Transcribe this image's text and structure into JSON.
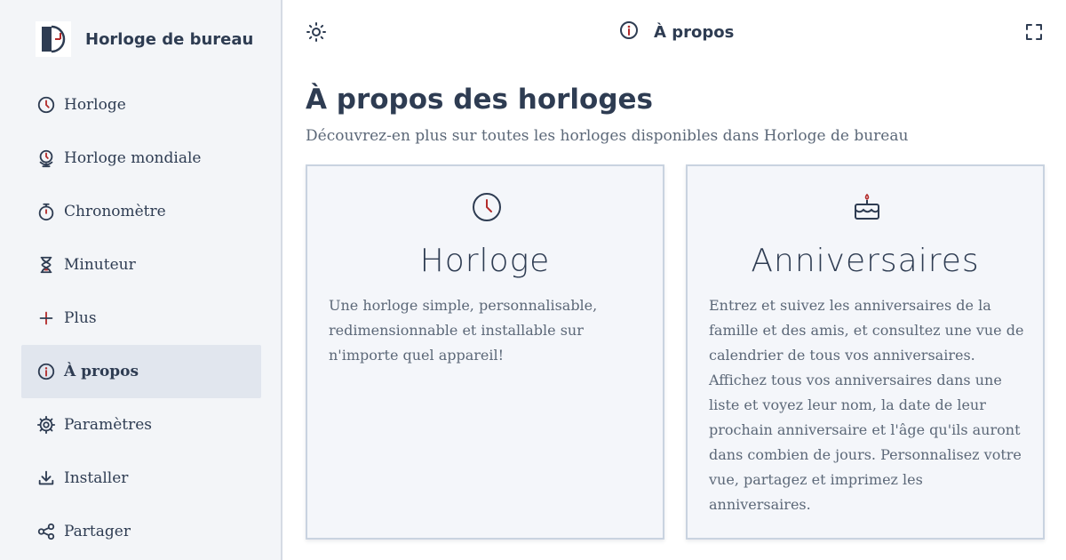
{
  "app": {
    "title": "Horloge de bureau",
    "logo_icon": "desk-clock-logo"
  },
  "sidebar": {
    "items": [
      {
        "label": "Horloge",
        "icon": "clock-icon",
        "active": false
      },
      {
        "label": "Horloge mondiale",
        "icon": "world-clock-icon",
        "active": false
      },
      {
        "label": "Chronomètre",
        "icon": "stopwatch-icon",
        "active": false
      },
      {
        "label": "Minuteur",
        "icon": "hourglass-icon",
        "active": false
      },
      {
        "label": "Plus",
        "icon": "plus-icon",
        "active": false
      },
      {
        "label": "À propos",
        "icon": "info-icon",
        "active": true
      },
      {
        "label": "Paramètres",
        "icon": "gear-icon",
        "active": false
      },
      {
        "label": "Installer",
        "icon": "download-icon",
        "active": false
      },
      {
        "label": "Partager",
        "icon": "share-icon",
        "active": false
      }
    ]
  },
  "topbar": {
    "title": "À propos",
    "title_icon": "info-icon",
    "theme_icon": "sun-icon",
    "fullscreen_icon": "fullscreen-icon"
  },
  "main": {
    "title": "À propos des horloges",
    "subtitle": "Découvrez-en plus sur toutes les horloges disponibles dans Horloge de bureau",
    "cards": [
      {
        "icon": "clock-icon",
        "title": "Horloge",
        "description": "Une horloge simple, personnalisable, redimensionnable et installable sur n'importe quel appareil!"
      },
      {
        "icon": "birthday-cake-icon",
        "title": "Anniversaires",
        "description": "Entrez et suivez les anniversaires de la famille et des amis, et consultez une vue de calendrier de tous vos anniversaires. Affichez tous vos anniversaires dans une liste et voyez leur nom, la date de leur prochain anniversaire et l'âge qu'ils auront dans combien de jours. Personnalisez votre vue, partagez et imprimez les anniversaires."
      }
    ]
  },
  "colors": {
    "text": "#2e3c52",
    "accent": "#b32b2b",
    "sidebar_bg": "#f3f5f8",
    "active_bg": "#e1e6ee",
    "card_border": "#c9d3e0"
  }
}
